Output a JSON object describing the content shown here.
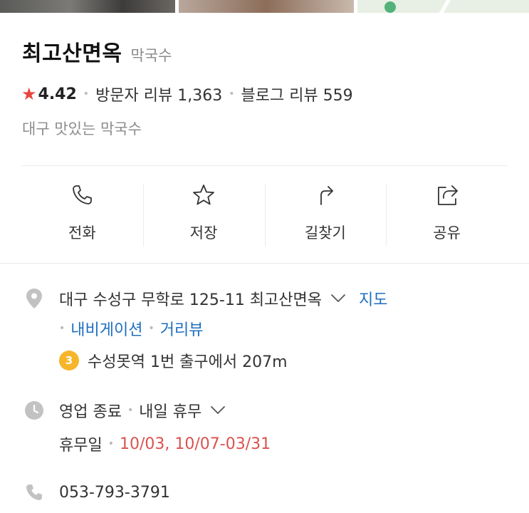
{
  "place": {
    "name": "최고산면옥",
    "category": "막국수",
    "rating": "4.42",
    "visitor_reviews": "방문자 리뷰 1,363",
    "blog_reviews": "블로그 리뷰 559",
    "description": "대구 맛있는 막국수"
  },
  "actions": [
    {
      "label": "전화",
      "icon": "phone-icon"
    },
    {
      "label": "저장",
      "icon": "star-icon"
    },
    {
      "label": "길찾기",
      "icon": "directions-icon"
    },
    {
      "label": "공유",
      "icon": "share-icon"
    }
  ],
  "address": {
    "text": "대구 수성구 무학로 125-11 최고산면옥",
    "map_link": "지도",
    "navigation_link": "내비게이션",
    "street_view_link": "거리뷰",
    "subway_line": "3",
    "subway_line_color": "#f7b52a",
    "directions": "수성못역 1번 출구에서 207m"
  },
  "hours": {
    "status": "영업 종료",
    "next": "내일 휴무",
    "holiday_label": "휴무일",
    "holiday_dates": "10/03, 10/07-03/31"
  },
  "phone": "053-793-3791",
  "colors": {
    "star": "#e9443e",
    "link": "#1f6fbf",
    "holiday": "#d9534f"
  }
}
